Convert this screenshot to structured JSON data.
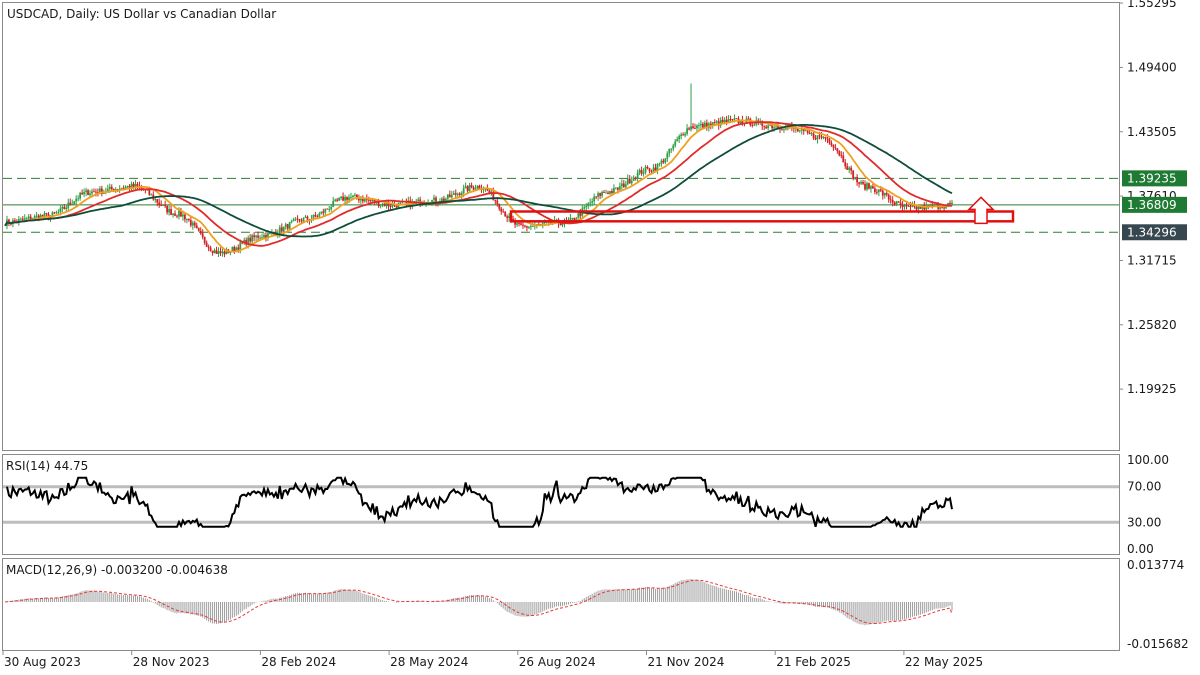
{
  "header": {
    "symbol_title": "USDCAD, Daily:  US Dollar vs Canadian Dollar"
  },
  "colors": {
    "bull_candle": "#2e9e45",
    "bear_candle": "#d11e1e",
    "ma_fast": "#f0a020",
    "ma_mid": "#e22a2a",
    "ma_slow": "#0f4d3a",
    "level_line": "#2e7d32",
    "support_box": "#e01010",
    "arrow": "#e01010",
    "badge_green": "#1f7a33",
    "badge_dark": "#37474f",
    "rsi_line": "#000000",
    "rsi_level": "#bdbdbd",
    "macd_hist": "#9e9e9e",
    "macd_signal": "#e53935"
  },
  "chart_data": [
    {
      "type": "candlestick",
      "title": "USDCAD, Daily:  US Dollar vs Canadian Dollar",
      "price_axis_ticks": [
        "1.55295",
        "1.49400",
        "1.43505",
        "1.37610",
        "1.31715",
        "1.25820",
        "1.19925"
      ],
      "ylim": [
        1.1435,
        1.553
      ],
      "time_axis_ticks": [
        "30 Aug 2023",
        "28 Nov 2023",
        "28 Feb 2024",
        "28 May 2024",
        "26 Aug 2024",
        "21 Nov 2024",
        "21 Feb 2025",
        "22 May 2025"
      ],
      "horizontal_levels": [
        {
          "value": 1.39235,
          "label": "1.39235",
          "style": "dashed",
          "badge": "green"
        },
        {
          "value": 1.36809,
          "label": "1.36809",
          "style": "solid",
          "badge": "green"
        },
        {
          "value": 1.34296,
          "label": "1.34296",
          "style": "dashed",
          "badge": "dark"
        }
      ],
      "support_zone": {
        "from": 1.353,
        "to": 1.362
      },
      "close_series_anchors": [
        [
          "30 Aug 2023",
          1.352
        ],
        [
          "Sep 2023",
          1.358
        ],
        [
          "Oct 2023",
          1.38
        ],
        [
          "Oct 2023 end",
          1.385
        ],
        [
          "28 Nov 2023",
          1.36
        ],
        [
          "Dec 2023",
          1.324
        ],
        [
          "Jan 2024",
          1.34
        ],
        [
          "28 Feb 2024",
          1.355
        ],
        [
          "Apr 2024",
          1.375
        ],
        [
          "28 May 2024",
          1.368
        ],
        [
          "Jul 2024",
          1.372
        ],
        [
          "Aug 2024",
          1.385
        ],
        [
          "26 Aug 2024",
          1.348
        ],
        [
          "Sep 2024",
          1.352
        ],
        [
          "Oct 2024",
          1.38
        ],
        [
          "21 Nov 2024",
          1.401
        ],
        [
          "Dec 2024",
          1.44
        ],
        [
          "Jan 2025",
          1.445
        ],
        [
          "21 Feb 2025",
          1.44
        ],
        [
          "Mar 2025",
          1.43
        ],
        [
          "Apr 2025",
          1.385
        ],
        [
          "22 May 2025",
          1.365
        ],
        [
          "Jun 2025",
          1.368
        ]
      ],
      "spike_high": {
        "date": "Feb 2025",
        "value": 1.4793
      },
      "series": [
        {
          "name": "MA fast",
          "color": "#f0a020"
        },
        {
          "name": "MA mid",
          "color": "#e22a2a"
        },
        {
          "name": "MA slow",
          "color": "#0f4d3a"
        }
      ]
    },
    {
      "type": "line",
      "title": "RSI(14) 44.75",
      "ylim": [
        0,
        100
      ],
      "tick_labels": [
        "100.00",
        "70.00",
        "30.00",
        "0.00"
      ],
      "levels": [
        70,
        30
      ],
      "last_value": 44.75
    },
    {
      "type": "bar",
      "title": "MACD(12,26,9) -0.003200 -0.004638",
      "tick_labels": [
        "0.013774",
        "-0.015682"
      ],
      "ylim": [
        -0.015682,
        0.013774
      ],
      "last_macd": -0.0032,
      "last_signal": -0.004638
    }
  ]
}
